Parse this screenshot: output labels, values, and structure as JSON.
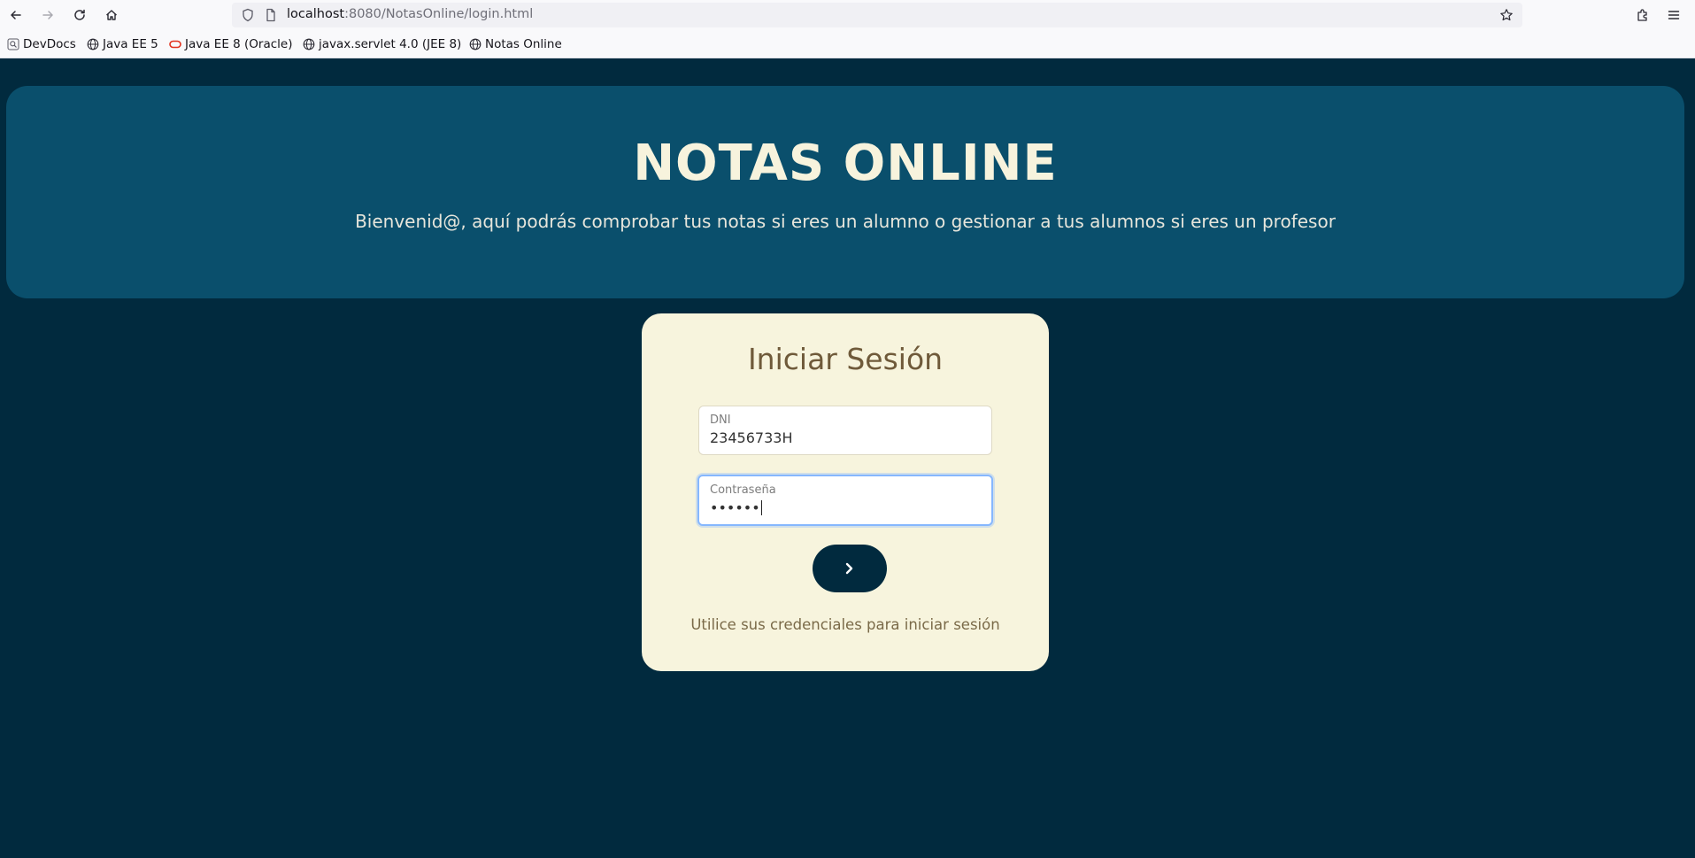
{
  "browser": {
    "url_host": "localhost",
    "url_rest": ":8080/NotasOnline/login.html",
    "bookmarks": [
      {
        "label": "DevDocs",
        "icon": "search-icon"
      },
      {
        "label": "Java EE 5",
        "icon": "globe-icon"
      },
      {
        "label": "Java EE 8 (Oracle)",
        "icon": "oracle-icon"
      },
      {
        "label": "javax.servlet 4.0 (JEE 8)",
        "icon": "globe-icon"
      },
      {
        "label": "Notas Online",
        "icon": "globe-icon"
      }
    ]
  },
  "header": {
    "title": "NOTAS ONLINE",
    "subtitle": "Bienvenid@, aquí podrás comprobar tus notas si eres un alumno o gestionar a tus alumnos si eres un profesor"
  },
  "login": {
    "title": "Iniciar Sesión",
    "dni_label": "DNI",
    "dni_value": "23456733H",
    "password_label": "Contraseña",
    "password_value": "••••••",
    "submit_icon": "chevron-right-icon",
    "footer": "Utilice sus credenciales para iniciar sesión"
  },
  "colors": {
    "page_bg": "#012a3e",
    "header_bg": "#0a4f6c",
    "card_bg": "#f7f4dd",
    "title_color": "#f7f3dd",
    "accent_brown": "#6f5a3a"
  }
}
